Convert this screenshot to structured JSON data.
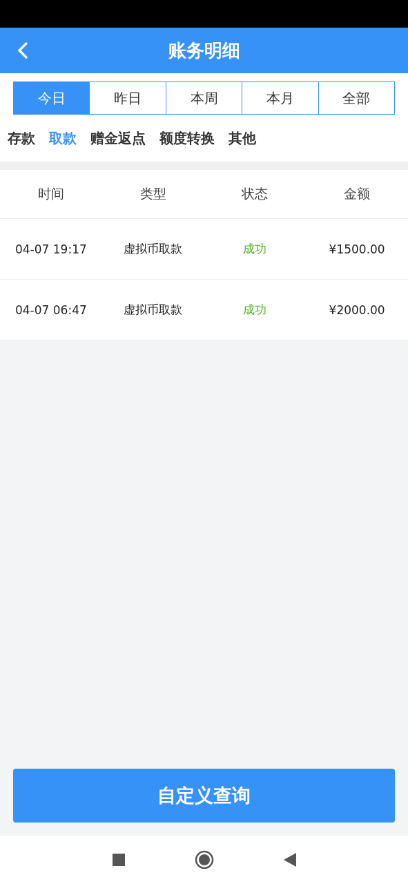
{
  "header": {
    "title": "账务明细"
  },
  "period_tabs": [
    {
      "label": "今日",
      "selected": true
    },
    {
      "label": "昨日",
      "selected": false
    },
    {
      "label": "本周",
      "selected": false
    },
    {
      "label": "本月",
      "selected": false
    },
    {
      "label": "全部",
      "selected": false
    }
  ],
  "categories": [
    {
      "label": "存款",
      "selected": false
    },
    {
      "label": "取款",
      "selected": true
    },
    {
      "label": "赠金返点",
      "selected": false
    },
    {
      "label": "额度转换",
      "selected": false
    },
    {
      "label": "其他",
      "selected": false
    }
  ],
  "table": {
    "columns": [
      "时间",
      "类型",
      "状态",
      "金额"
    ],
    "rows": [
      {
        "time": "04-07 19:17",
        "type": "虚拟币取款",
        "status": "成功",
        "color": "#4fb32a",
        "amount": "¥1500.00"
      },
      {
        "time": "04-07 06:47",
        "type": "虚拟币取款",
        "status": "成功",
        "color": "#4fb32a",
        "amount": "¥2000.00"
      }
    ]
  },
  "query_button": "自定义查询"
}
